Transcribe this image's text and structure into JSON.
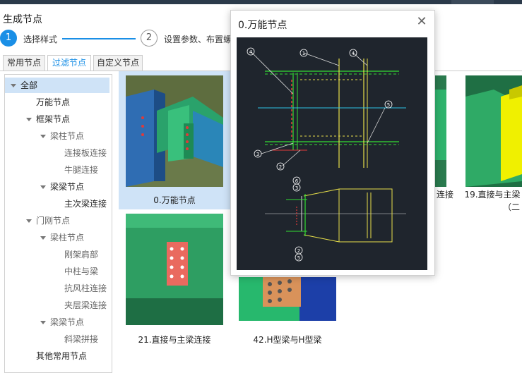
{
  "window": {
    "title": "生成节点"
  },
  "steps": [
    {
      "number": "1",
      "label": "选择样式",
      "active": true
    },
    {
      "number": "2",
      "label": "设置参数、布置螺",
      "active": false
    }
  ],
  "tabs": [
    {
      "label": "常用节点",
      "active": false
    },
    {
      "label": "过滤节点",
      "active": true
    },
    {
      "label": "自定义节点",
      "active": false
    }
  ],
  "tree": [
    {
      "label": "全部",
      "level": 0,
      "expanded": true,
      "selected": true
    },
    {
      "label": "万能节点",
      "level": 1
    },
    {
      "label": "框架节点",
      "level": 1,
      "expanded": true
    },
    {
      "label": "梁柱节点",
      "level": 2,
      "expanded": true
    },
    {
      "label": "连接板连接",
      "level": 3
    },
    {
      "label": "牛腿连接",
      "level": 3
    },
    {
      "label": "梁梁节点",
      "level": 2,
      "expanded": true
    },
    {
      "label": "主次梁连接",
      "level": 3
    },
    {
      "label": "门刚节点",
      "level": 1,
      "expanded": true
    },
    {
      "label": "梁柱节点",
      "level": 2,
      "expanded": true
    },
    {
      "label": "刚架肩部",
      "level": 3
    },
    {
      "label": "中柱与梁",
      "level": 3
    },
    {
      "label": "抗风柱连接",
      "level": 3
    },
    {
      "label": "夹层梁连接",
      "level": 3
    },
    {
      "label": "梁梁节点",
      "level": 2,
      "expanded": true
    },
    {
      "label": "斜梁拼接",
      "level": 3
    },
    {
      "label": "其他常用节点",
      "level": 1
    }
  ],
  "gallery": {
    "cards": [
      {
        "caption": "0.万能节点",
        "selected": true
      },
      {
        "caption": "连接"
      },
      {
        "caption": "19.直接与主梁",
        "caption2": "（二"
      },
      {
        "caption": "21.直接与主梁连接"
      },
      {
        "caption": "42.H型梁与H型梁"
      }
    ]
  },
  "popup": {
    "title": "0.万能节点",
    "close_icon": "close-icon",
    "callouts": [
      "4",
      "1",
      "4",
      "5",
      "3",
      "2",
      "6",
      "3",
      "2",
      "5"
    ]
  },
  "colors": {
    "accent": "#1a8fe6",
    "selection": "#cfe3f7",
    "drawing_bg": "#1f252d"
  }
}
